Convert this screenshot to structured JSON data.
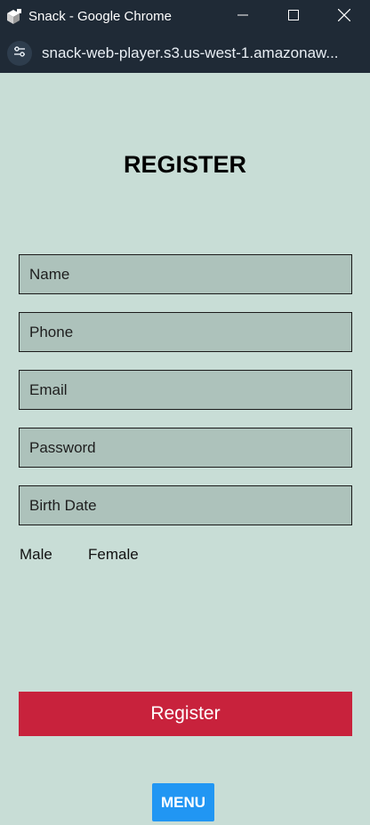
{
  "window": {
    "title": "Snack - Google Chrome",
    "url": "snack-web-player.s3.us-west-1.amazonaw..."
  },
  "icons": {
    "app": "snack-app-icon",
    "site_info": "site-settings-icon",
    "minimize": "minimize-icon",
    "maximize": "maximize-icon",
    "close": "close-icon"
  },
  "form": {
    "heading": "REGISTER",
    "fields": [
      {
        "placeholder": "Name",
        "value": ""
      },
      {
        "placeholder": "Phone",
        "value": ""
      },
      {
        "placeholder": "Email",
        "value": ""
      },
      {
        "placeholder": "Password",
        "value": ""
      },
      {
        "placeholder": "Birth Date",
        "value": ""
      }
    ],
    "gender_options": [
      "Male",
      "Female"
    ],
    "register_label": "Register",
    "menu_label": "MENU"
  },
  "colors": {
    "page_background": "#c8ddd6",
    "input_background": "#adc2bb",
    "register_button": "#c8223c",
    "menu_button": "#2196f3",
    "titlebar": "#1f2a36"
  }
}
